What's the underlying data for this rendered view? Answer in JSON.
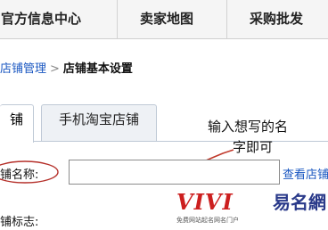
{
  "top_nav": {
    "items": [
      "官方信息中心",
      "卖家地图",
      "采购批发"
    ]
  },
  "breadcrumb": {
    "parent": "店铺管理",
    "separator": ">",
    "current": "店铺基本设置"
  },
  "tabs": {
    "active": "铺",
    "inactive": "手机淘宝店铺"
  },
  "annotation": {
    "line1": "输入想写的名",
    "line2": "字即可"
  },
  "form": {
    "shop_name_label": "铺名称:",
    "shop_name_value": "",
    "view_link": "查看店铺",
    "shop_logo_label": "铺标志:"
  },
  "watermark": {
    "latin": "VIVI",
    "chinese": "易名網",
    "tagline": "免费网站起名网名门户"
  },
  "colors": {
    "link": "#1a57c1",
    "annotation_arrow": "#c0392b",
    "watermark_red": "#cc1f1f",
    "watermark_blue": "#2a3a8a"
  }
}
